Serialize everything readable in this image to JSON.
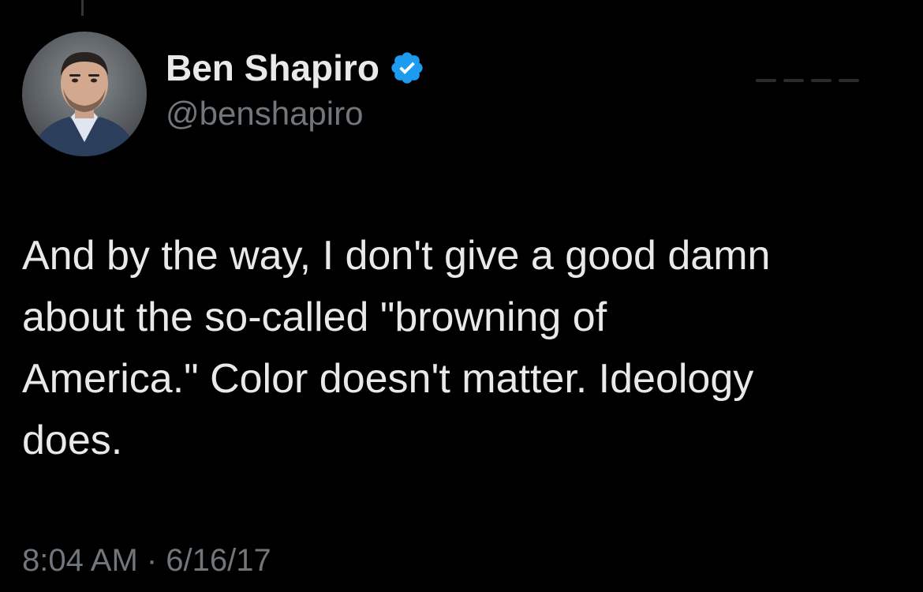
{
  "author": {
    "display_name": "Ben Shapiro",
    "handle": "@benshapiro",
    "verified": true,
    "verified_badge_color": "#1d9bf0",
    "avatar_icon": "profile-photo"
  },
  "tweet": {
    "text": "And by the way, I don't give a good damn\nabout the so-called \"browning of\nAmerica.\" Color doesn't matter. Ideology\ndoes.",
    "timestamp": "8:04 AM · 6/16/17"
  },
  "colors": {
    "background": "#000000",
    "primary_text": "#e7e9ea",
    "secondary_text": "#71767b"
  }
}
